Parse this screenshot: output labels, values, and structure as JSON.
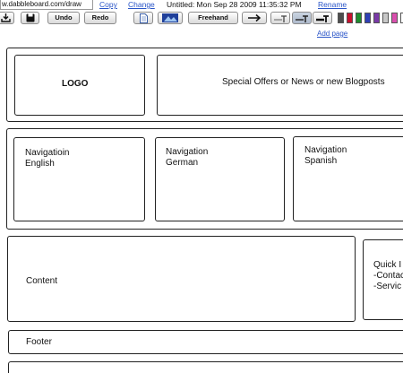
{
  "window": {
    "url": "w.dabbleboard.com/draw",
    "copy_label": "Copy",
    "change_label": "Change",
    "title": "Untitled: Mon Sep 28 2009 11:35:32 PM",
    "rename_label": "Rename"
  },
  "toolbar": {
    "undo_label": "Undo",
    "redo_label": "Redo",
    "freehand_label": "Freehand",
    "add_page_label": "Add page",
    "colors": [
      "#4d4d4d",
      "#c8102e",
      "#1e8c2e",
      "#2f3fb5",
      "#7a3aa8",
      "#c8c8c8",
      "#d94fae",
      "#ffffff"
    ]
  },
  "canvas": {
    "logo": "LOGO",
    "banner": "Special Offers or News or new Blogposts",
    "nav_english": [
      "Navigatioin",
      "English"
    ],
    "nav_german": [
      "Navigation",
      "German"
    ],
    "nav_spanish": [
      "Navigation",
      "Spanish"
    ],
    "content": "Content",
    "quick_links": [
      "Quick I",
      "-Contac",
      "-Servic"
    ],
    "footer": "Footer"
  }
}
